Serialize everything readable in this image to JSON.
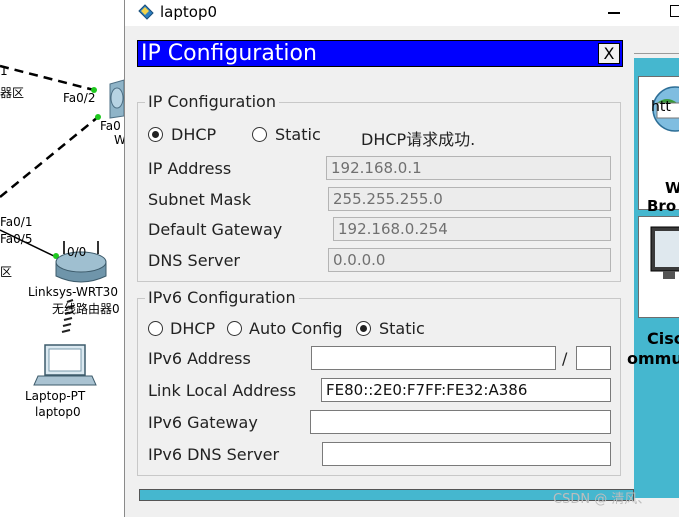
{
  "topology": {
    "labels": {
      "fa02": "Fa0/2",
      "fa0_partial": "Fa0",
      "w_partial": "W",
      "fa01": "Fa0/1",
      "fa05": "Fa0/5",
      "port_00": "0/0",
      "area_top": "器区",
      "area_mid": "区",
      "router_model": "Linksys-WRT30",
      "router_name": "无线路由器0",
      "laptop_model": "Laptop-PT",
      "laptop_name": "laptop0",
      "edge_one": "1"
    }
  },
  "window": {
    "title": "laptop0"
  },
  "desktop": {
    "browser_partial": "htt",
    "browser_label_1": "W",
    "browser_label_2": "Bro",
    "cisco_label_1": "Cisc",
    "cisco_label_2": "ommu"
  },
  "panel": {
    "title": "IP Configuration",
    "close": "X",
    "ipv4": {
      "group_title": "IP Configuration",
      "mode_dhcp": "DHCP",
      "mode_static": "Static",
      "selected_mode": "DHCP",
      "status": "DHCP请求成功.",
      "ip_label": "IP Address",
      "ip_value": "192.168.0.1",
      "mask_label": "Subnet Mask",
      "mask_value": "255.255.255.0",
      "gateway_label": "Default Gateway",
      "gateway_value": "192.168.0.254",
      "dns_label": "DNS Server",
      "dns_value": "0.0.0.0"
    },
    "ipv6": {
      "group_title": "IPv6 Configuration",
      "mode_dhcp": "DHCP",
      "mode_auto": "Auto Config",
      "mode_static": "Static",
      "selected_mode": "Static",
      "address_label": "IPv6 Address",
      "address_value": "",
      "prefix_separator": "/",
      "prefix_value": "",
      "link_local_label": "Link Local Address",
      "link_local_value": "FE80::2E0:F7FF:FE32:A386",
      "gateway_label": "IPv6 Gateway",
      "gateway_value": "",
      "dns_label": "IPv6 DNS Server",
      "dns_value": ""
    }
  },
  "watermark": "CSDN @ 清风、",
  "colors": {
    "panel_header": "#0000ff",
    "desktop_accent": "#45b7cf"
  }
}
